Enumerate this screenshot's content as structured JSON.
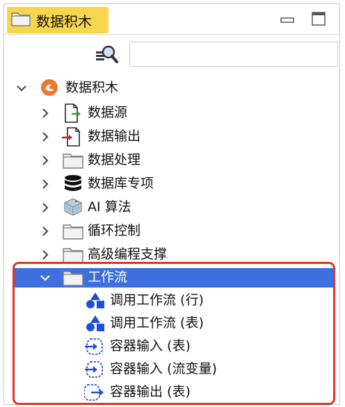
{
  "panel": {
    "title": "数据积木",
    "search": {
      "value": "",
      "placeholder": ""
    }
  },
  "tree": {
    "root": {
      "label": "数据积木",
      "expanded": true
    },
    "children": [
      {
        "label": "数据源",
        "icon": "data-source-icon",
        "expanded": false
      },
      {
        "label": "数据输出",
        "icon": "data-output-icon",
        "expanded": false
      },
      {
        "label": "数据处理",
        "icon": "folder-icon",
        "expanded": false
      },
      {
        "label": "数据库专项",
        "icon": "database-icon",
        "expanded": false
      },
      {
        "label": "AI 算法",
        "icon": "ai-cube-icon",
        "expanded": false
      },
      {
        "label": "循环控制",
        "icon": "folder-icon",
        "expanded": false
      },
      {
        "label": "高级编程支撑",
        "icon": "folder-icon",
        "expanded": false
      },
      {
        "label": "工作流",
        "icon": "folder-icon",
        "expanded": true,
        "selected": true
      }
    ],
    "workflow_items": [
      {
        "label": "调用工作流 (行)",
        "icon": "shapes-icon"
      },
      {
        "label": "调用工作流 (表)",
        "icon": "shapes-icon"
      },
      {
        "label": "容器输入 (表)",
        "icon": "container-input-icon"
      },
      {
        "label": "容器输入 (流变量)",
        "icon": "container-input-icon"
      },
      {
        "label": "容器输出 (表)",
        "icon": "container-output-icon"
      }
    ]
  },
  "colors": {
    "title_tab": "#f5d64e",
    "selection": "#3d6fdf",
    "highlight_border": "#e0351f",
    "shape_blue": "#1f4fd8"
  }
}
